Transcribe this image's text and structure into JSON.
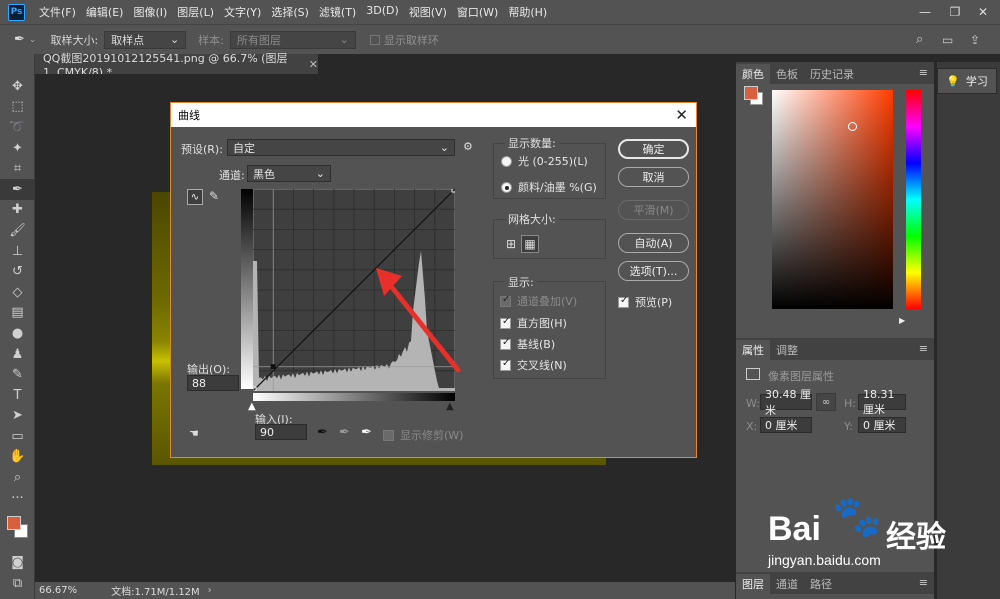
{
  "menubar": {
    "logo": "Ps",
    "items": [
      "文件(F)",
      "编辑(E)",
      "图像(I)",
      "图层(L)",
      "文字(Y)",
      "选择(S)",
      "滤镜(T)",
      "3D(D)",
      "视图(V)",
      "窗口(W)",
      "帮助(H)"
    ]
  },
  "options": {
    "sample_size_label": "取样大小:",
    "sample_size_value": "取样点",
    "sample_label": "样本:",
    "sample_value": "所有图层",
    "show_ring_label": "显示取样环"
  },
  "document": {
    "tab_title": "QQ截图20191012125541.png @ 66.7% (图层 1, CMYK/8) *",
    "zoom": "66.67%",
    "doc_size": "文档:1.71M/1.12M"
  },
  "curves": {
    "title": "曲线",
    "preset_label": "预设(R):",
    "preset_value": "自定",
    "channel_label": "通道:",
    "channel_value": "黑色",
    "output_label": "输出(O):",
    "output_value": "88",
    "input_label": "输入(I):",
    "input_value": "90",
    "show_clipping": "显示修剪(W)",
    "display_amount_title": "显示数量:",
    "light_option": "光 (0-255)(L)",
    "pigment_option": "颜料/油墨 %(G)",
    "grid_size_title": "网格大小:",
    "show_title": "显示:",
    "channel_overlay": "通道叠加(V)",
    "histogram": "直方图(H)",
    "baseline": "基线(B)",
    "intersection": "交叉线(N)",
    "ok": "确定",
    "cancel": "取消",
    "smooth": "平滑(M)",
    "auto": "自动(A)",
    "options": "选项(T)...",
    "preview": "预览(P)",
    "curve_point": {
      "input": 90,
      "output": 88
    }
  },
  "color_panel": {
    "tabs": [
      "颜色",
      "色板",
      "历史记录"
    ],
    "foreground": "#d9603e"
  },
  "properties_panel": {
    "tabs": [
      "属性",
      "调整"
    ],
    "subtitle": "像素图层属性",
    "w_label": "W:",
    "w_value": "30.48 厘米",
    "h_label": "H:",
    "h_value": "18.31 厘米",
    "x_label": "X:",
    "x_value": "0 厘米",
    "y_label": "Y:",
    "y_value": "0 厘米"
  },
  "layers_panel": {
    "tabs": [
      "图层",
      "通道",
      "路径"
    ]
  },
  "learn": {
    "label": "学习"
  },
  "watermark": {
    "brand": "Bai",
    "brand2": "经验",
    "url": "jingyan.baidu.com"
  }
}
